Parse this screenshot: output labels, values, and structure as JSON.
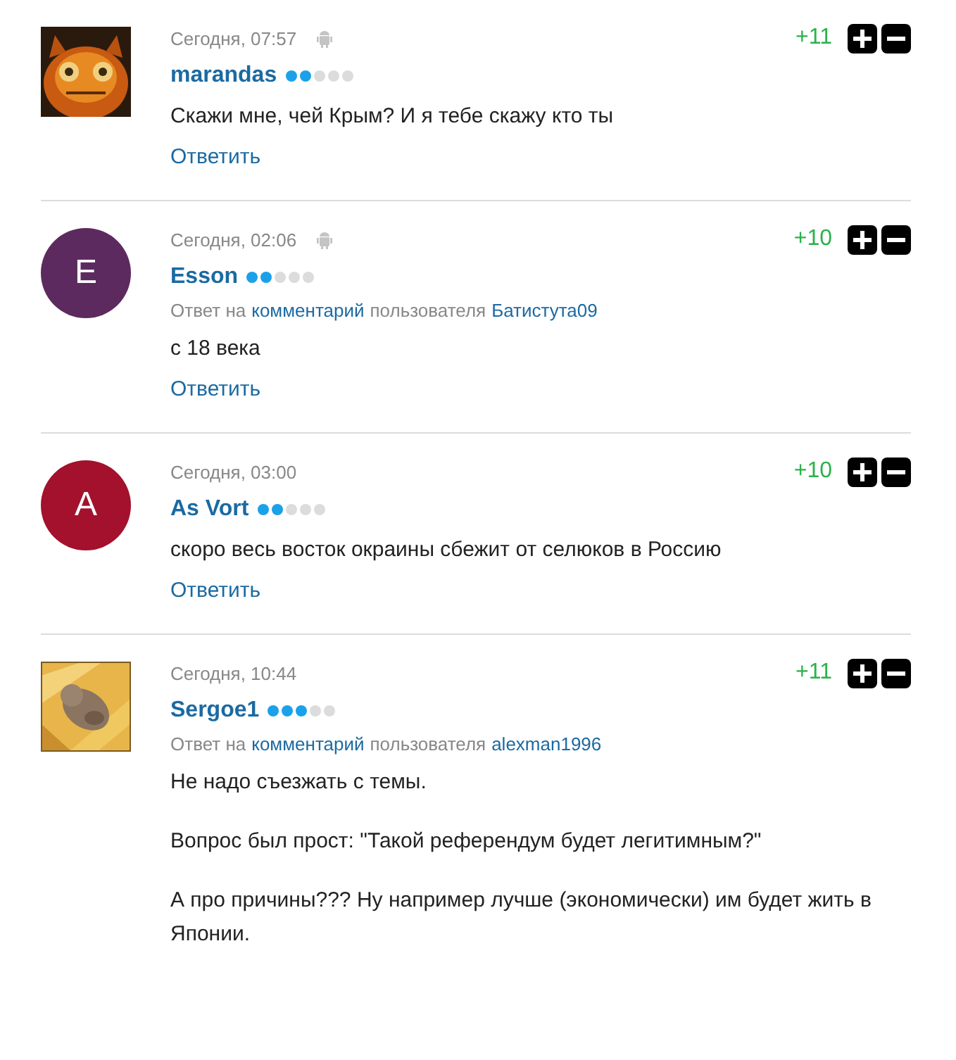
{
  "comments": [
    {
      "avatar": {
        "kind": "picture"
      },
      "time": "Сегодня, 07:57",
      "mobile": true,
      "score": "+11",
      "author": "marandas",
      "stars": 2,
      "body": [
        "Скажи мне, чей Крым? И я тебе скажу кто ты"
      ],
      "reply_label": "Ответить"
    },
    {
      "avatar": {
        "kind": "letter",
        "letter": "E",
        "color": "#5c2a5f"
      },
      "time": "Сегодня, 02:06",
      "mobile": true,
      "score": "+10",
      "author": "Esson",
      "stars": 2,
      "reply_to": {
        "prefix": "Ответ на",
        "link": "комментарий",
        "middle": "пользователя",
        "user": "Батистута09"
      },
      "body": [
        "с 18 века"
      ],
      "reply_label": "Ответить"
    },
    {
      "avatar": {
        "kind": "letter",
        "letter": "A",
        "color": "#a3112c"
      },
      "time": "Сегодня, 03:00",
      "mobile": false,
      "score": "+10",
      "author": "As Vort",
      "stars": 2,
      "body": [
        "скоро весь восток окраины сбежит от селюков в Россию"
      ],
      "reply_label": "Ответить"
    },
    {
      "avatar": {
        "kind": "picture"
      },
      "time": "Сегодня, 10:44",
      "mobile": false,
      "score": "+11",
      "author": "Sergoe1",
      "stars": 3,
      "reply_to": {
        "prefix": "Ответ на",
        "link": "комментарий",
        "middle": "пользователя",
        "user": "alexman1996"
      },
      "body": [
        "Не надо съезжать с темы.",
        "Вопрос был прост: \"Такой референдум будет легитимным?\"",
        "А про причины??? Ну например лучше (экономически) им будет жить в Японии."
      ]
    }
  ]
}
